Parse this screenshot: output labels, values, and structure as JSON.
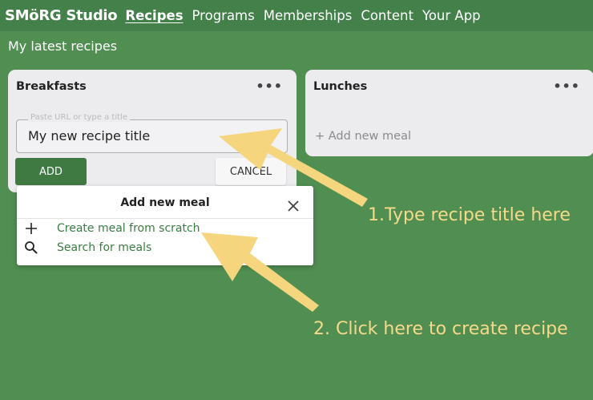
{
  "header": {
    "brand": "SMöRG Studio",
    "nav": [
      "Recipes",
      "Programs",
      "Memberships",
      "Content",
      "Your App"
    ]
  },
  "section_title": "My latest recipes",
  "cards": {
    "breakfasts": {
      "title": "Breakfasts",
      "menu": "•••",
      "input": {
        "placeholder": "Paste URL or type a title",
        "value": "My new recipe title"
      },
      "add_label": "ADD",
      "cancel_label": "CANCEL"
    },
    "lunches": {
      "title": "Lunches",
      "menu": "•••",
      "add_new_meal": "+ Add new meal"
    }
  },
  "popup": {
    "title": "Add new meal",
    "items": [
      "Create meal from scratch",
      "Search for meals"
    ]
  },
  "annotations": {
    "step1": "1.Type recipe title here",
    "step2": "2. Click here to create recipe"
  },
  "colors": {
    "background": "#518e52",
    "topbar": "#43804a",
    "card": "#ececef",
    "add_button": "#3f7a43",
    "link_green": "#3a7d41",
    "annotation_yellow": "#f7d98a"
  }
}
